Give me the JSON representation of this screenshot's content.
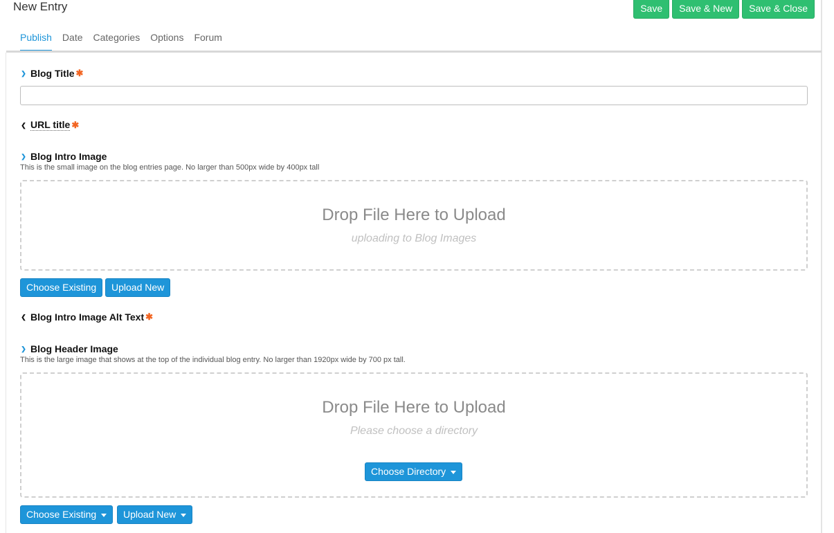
{
  "header": {
    "title": "New Entry"
  },
  "toolbar": {
    "save": "Save",
    "save_new": "Save & New",
    "save_close": "Save & Close"
  },
  "tabs": [
    {
      "label": "Publish",
      "active": true
    },
    {
      "label": "Date"
    },
    {
      "label": "Categories"
    },
    {
      "label": "Options"
    },
    {
      "label": "Forum"
    }
  ],
  "fields": {
    "blog_title": {
      "label": "Blog Title",
      "required_mark": "✱",
      "value": ""
    },
    "url_title": {
      "label": "URL title",
      "required_mark": "✱"
    },
    "intro_image": {
      "label": "Blog Intro Image",
      "description": "This is the small image on the blog entries page. No larger than 500px wide by 400px tall",
      "drop_title": "Drop File Here to Upload",
      "drop_sub": "uploading to Blog Images",
      "choose_existing": "Choose Existing",
      "upload_new": "Upload New"
    },
    "intro_alt": {
      "label": "Blog Intro Image Alt Text",
      "required_mark": "✱"
    },
    "header_image": {
      "label": "Blog Header Image",
      "description": "This is the large image that shows at the top of the individual blog entry. No larger than 1920px wide by 700 px tall.",
      "drop_title": "Drop File Here to Upload",
      "drop_sub": "Please choose a directory",
      "choose_directory": "Choose Directory",
      "choose_existing": "Choose Existing",
      "upload_new": "Upload New"
    }
  },
  "icons": {
    "expanded": "chevron-down-icon",
    "collapsed": "chevron-up-icon",
    "dropdown": "caret-down-icon"
  },
  "colors": {
    "green": "#2fbf71",
    "blue": "#1e95d9",
    "required": "#f26522"
  }
}
